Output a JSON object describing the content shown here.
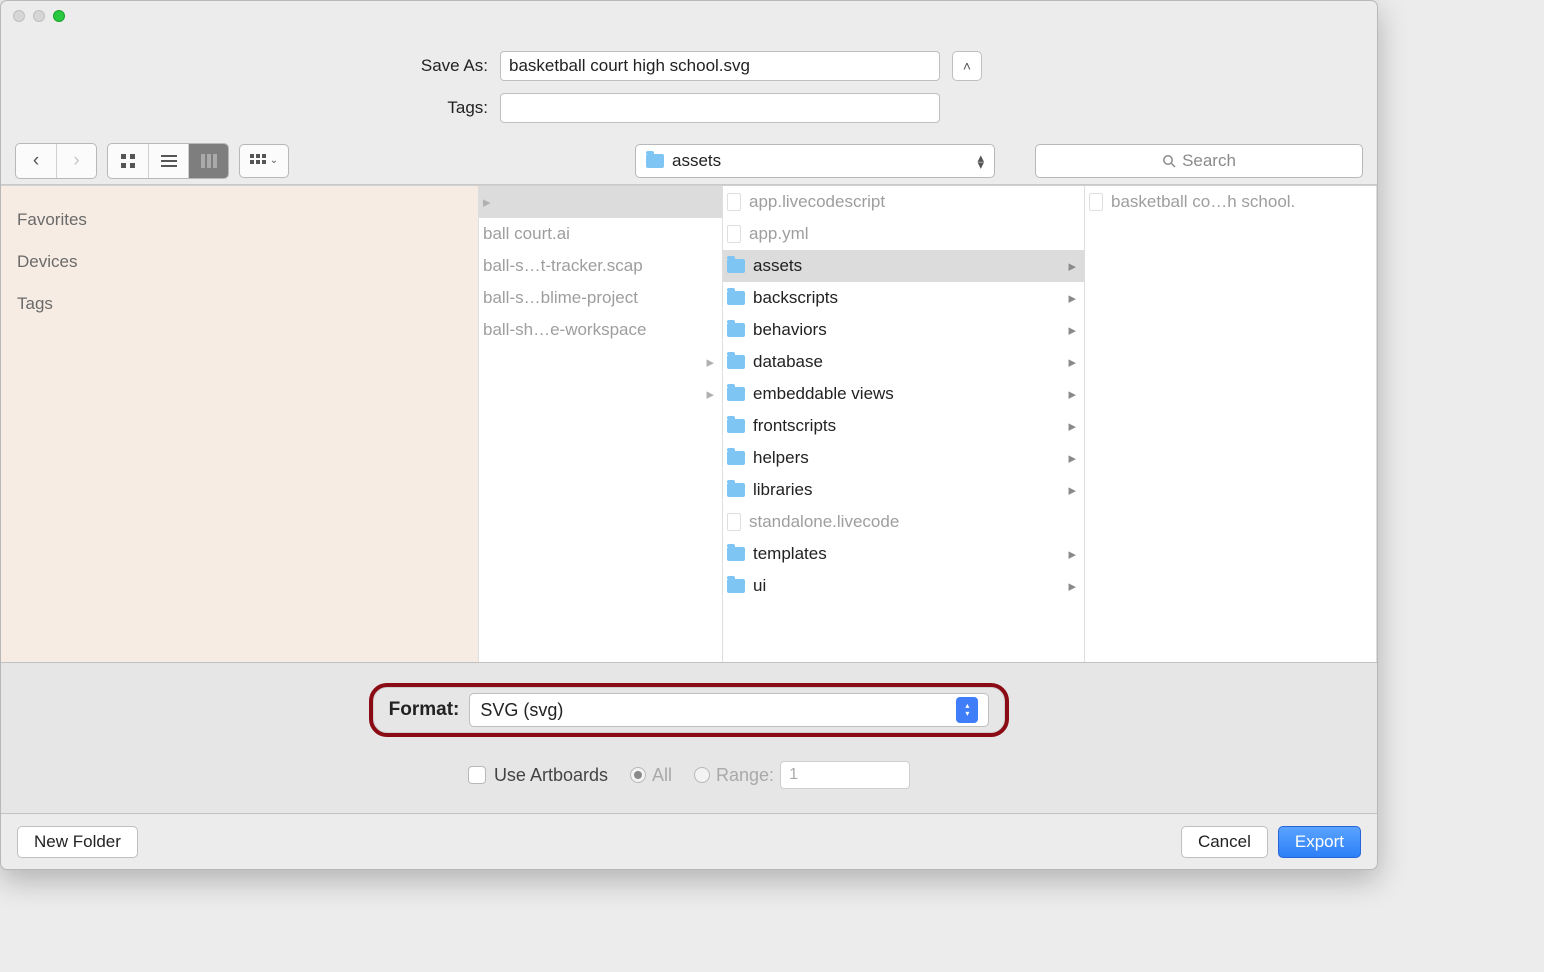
{
  "header": {
    "save_as_label": "Save As:",
    "filename": "basketball court high school.svg",
    "tags_label": "Tags:",
    "tags_value": ""
  },
  "toolbar": {
    "location_name": "assets",
    "search_placeholder": "Search"
  },
  "sidebar": {
    "sections": [
      "Favorites",
      "Devices",
      "Tags"
    ]
  },
  "col1": {
    "items": [
      {
        "name": "ball court.ai",
        "arrow": false
      },
      {
        "name": "ball-s…t-tracker.scap",
        "arrow": false
      },
      {
        "name": "ball-s…blime-project",
        "arrow": false
      },
      {
        "name": "ball-sh…e-workspace",
        "arrow": false
      },
      {
        "name": "",
        "arrow": true
      },
      {
        "name": "",
        "arrow": true
      }
    ]
  },
  "col2": {
    "items": [
      {
        "name": "app.livecodescript",
        "type": "file",
        "dim": true
      },
      {
        "name": "app.yml",
        "type": "file",
        "dim": true
      },
      {
        "name": "assets",
        "type": "folder",
        "arrow": true,
        "selected": true
      },
      {
        "name": "backscripts",
        "type": "folder",
        "arrow": true
      },
      {
        "name": "behaviors",
        "type": "folder",
        "arrow": true
      },
      {
        "name": "database",
        "type": "folder",
        "arrow": true
      },
      {
        "name": "embeddable views",
        "type": "folder",
        "arrow": true
      },
      {
        "name": "frontscripts",
        "type": "folder",
        "arrow": true
      },
      {
        "name": "helpers",
        "type": "folder",
        "arrow": true
      },
      {
        "name": "libraries",
        "type": "folder",
        "arrow": true
      },
      {
        "name": "standalone.livecode",
        "type": "file",
        "dim": true
      },
      {
        "name": "templates",
        "type": "folder",
        "arrow": true
      },
      {
        "name": "ui",
        "type": "folder",
        "arrow": true
      }
    ]
  },
  "col3": {
    "items": [
      {
        "name": "basketball co…h school.",
        "type": "file"
      }
    ]
  },
  "format": {
    "label": "Format:",
    "value": "SVG (svg)"
  },
  "artboards": {
    "use_label": "Use Artboards",
    "all_label": "All",
    "range_label": "Range:",
    "range_value": "1"
  },
  "footer": {
    "new_folder": "New Folder",
    "cancel": "Cancel",
    "export": "Export"
  }
}
